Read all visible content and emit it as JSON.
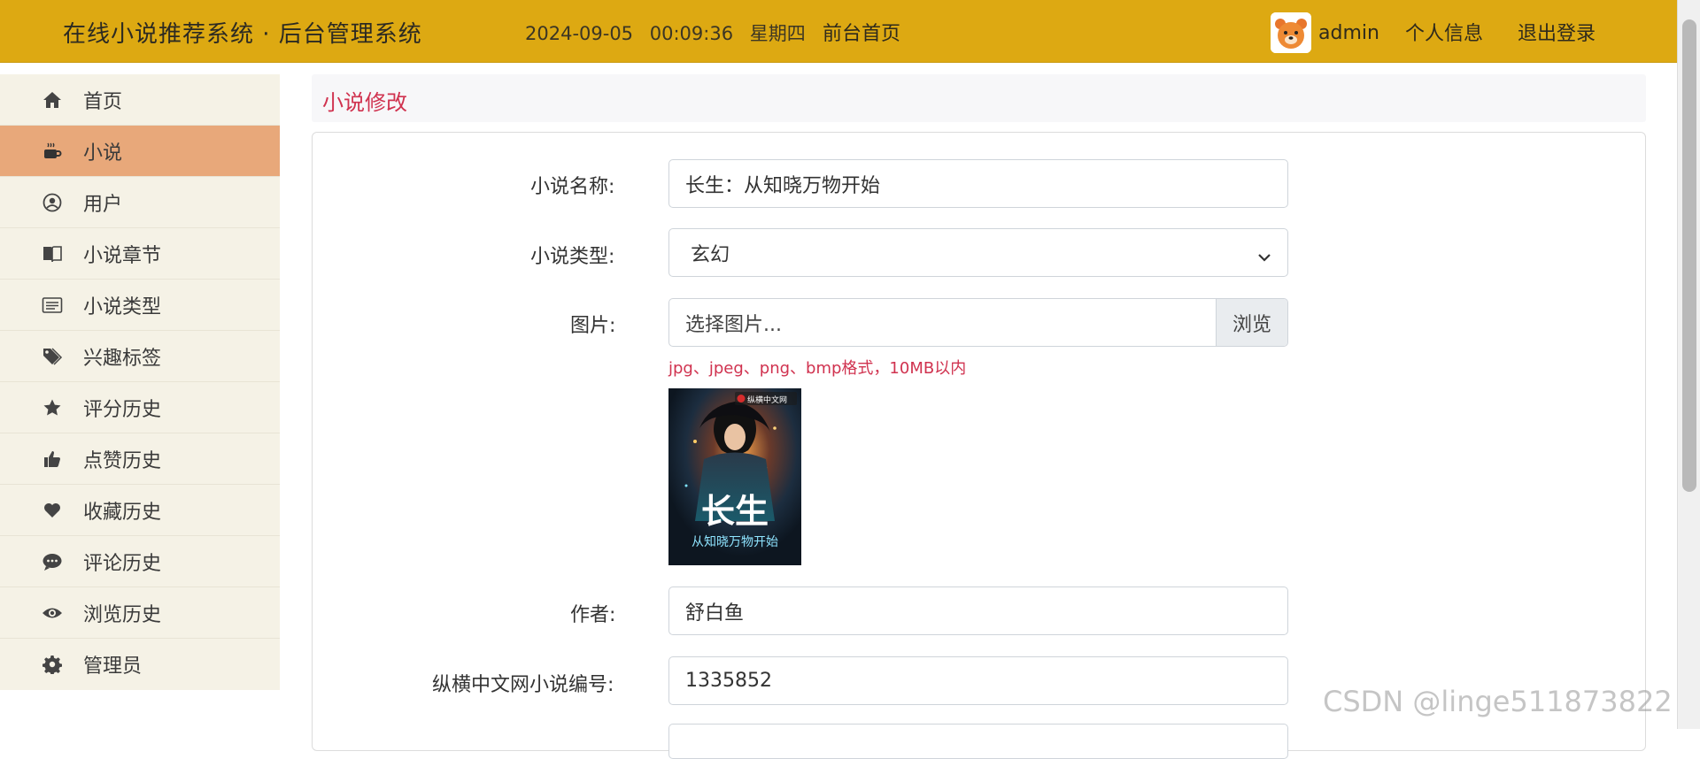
{
  "header": {
    "title": "在线小说推荐系统 · 后台管理系统",
    "date": "2024-09-05",
    "time": "00:09:36",
    "weekday": "星期四",
    "front_link": "前台首页",
    "username": "admin",
    "profile_link": "个人信息",
    "logout_link": "退出登录",
    "bg_color": "#dda912"
  },
  "sidebar": {
    "active_color": "#e8a87a",
    "items": [
      {
        "label": "首页",
        "icon": "home-icon"
      },
      {
        "label": "小说",
        "icon": "coffee-icon"
      },
      {
        "label": "用户",
        "icon": "user-circle-icon"
      },
      {
        "label": "小说章节",
        "icon": "book-open-icon"
      },
      {
        "label": "小说类型",
        "icon": "list-icon"
      },
      {
        "label": "兴趣标签",
        "icon": "tags-icon"
      },
      {
        "label": "评分历史",
        "icon": "star-icon"
      },
      {
        "label": "点赞历史",
        "icon": "thumbs-up-icon"
      },
      {
        "label": "收藏历史",
        "icon": "heart-icon"
      },
      {
        "label": "评论历史",
        "icon": "comment-icon"
      },
      {
        "label": "浏览历史",
        "icon": "eye-icon"
      },
      {
        "label": "管理员",
        "icon": "gear-icon"
      }
    ]
  },
  "page": {
    "title": "小说修改",
    "title_color": "#d0324f"
  },
  "form": {
    "name_label": "小说名称:",
    "name_value": "长生：从知晓万物开始",
    "type_label": "小说类型:",
    "type_value": "玄幻",
    "image_label": "图片:",
    "image_placeholder": "选择图片...",
    "browse_label": "浏览",
    "image_hint": "jpg、jpeg、png、bmp格式，10MB以内",
    "cover_badge": "纵横中文网",
    "cover_title": "长生",
    "cover_subtitle": "从知晓万物开始",
    "author_label": "作者:",
    "author_value": "舒白鱼",
    "zh_id_label": "纵横中文网小说编号:",
    "zh_id_value": "1335852"
  },
  "watermark": "CSDN @linge511873822"
}
